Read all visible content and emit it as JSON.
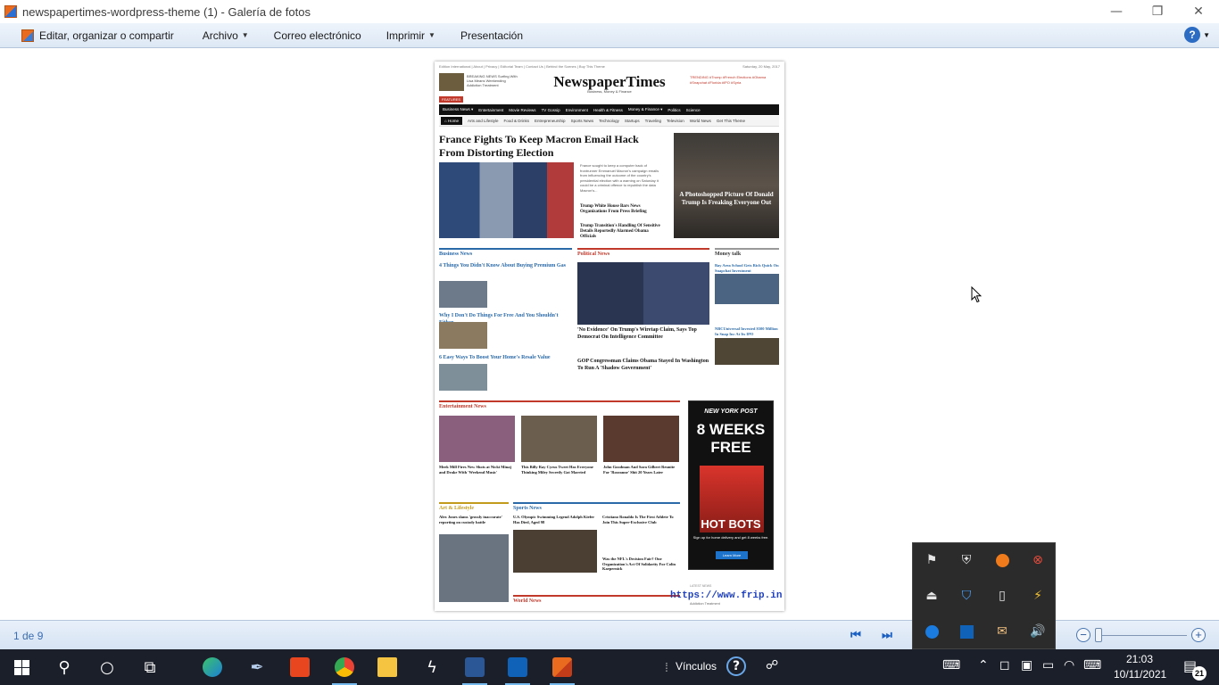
{
  "window": {
    "title": "newspapertimes-wordpress-theme (1) - Galería de fotos",
    "minimize_glyph": "—",
    "restore_glyph": "❐",
    "close_glyph": "✕"
  },
  "menubar": {
    "items": [
      {
        "label": "Editar, organizar o compartir",
        "has_dropdown": false
      },
      {
        "label": "Archivo",
        "has_dropdown": true
      },
      {
        "label": "Correo electrónico",
        "has_dropdown": false
      },
      {
        "label": "Imprimir",
        "has_dropdown": true
      },
      {
        "label": "Presentación",
        "has_dropdown": false
      }
    ],
    "help_glyph": "?"
  },
  "photo": {
    "top_links": "Edition International | About | Privacy | Editorial Team | Contact Us | Behind the Scenes | Buy This Theme",
    "top_date": "Saturday, 20 May, 2017",
    "logo": "NewspaperTimes",
    "logo_sub": "Business, Money & Finance",
    "breaking": "BREAKING NEWS Surfing With Lisa Means Weekending Addiction Treatment",
    "trending": "TRENDING #Trump #French Elections #Obama #Snapchat #Florida #IPO #Syria",
    "features_label": "FEATURES",
    "nav_primary": [
      "Business News ▾",
      "Entertainment",
      "Movie Reviews",
      "TV Gossip",
      "Environment",
      "Health & Fitness",
      "Money & Finance ▾",
      "Politics",
      "Science"
    ],
    "nav_secondary": [
      "⌂ Home",
      "Arts and Lifestyle",
      "Food & Drinks",
      "Entrepreneurship",
      "Sports News",
      "Technology",
      "Startups",
      "Traveling",
      "Television",
      "World News",
      "Get This Theme"
    ],
    "headline": "France Fights To Keep Macron Email Hack From Distorting Election",
    "main_text": "France sought to keep a computer hack of frontrunner Emmanuel Macron's campaign emails from influencing the outcome of the country's presidential election with a warning on Saturday it could be a criminal offence to republish the data Macron's...",
    "side_head_1": "Trump White House Bars News Organizations From Press Briefing",
    "side_head_2": "Trump Transition's Handling Of Sensitive Details Reportedly Alarmed Obama Officials",
    "right_caption": "A Photoshopped Picture Of Donald Trump Is Freaking Everyone Out",
    "sections": {
      "business": "Business News",
      "political": "Political News",
      "money": "Money talk",
      "entertainment": "Entertainment News",
      "art": "Art & Lifestyle",
      "sports": "Sports News",
      "world": "World News"
    },
    "business_articles": [
      "4 Things You Didn't Know About Buying Premium Gas",
      "Why I Don't Do Things For Free And You Shouldn't Either",
      "6 Easy Ways To Boost Your Home's Resale Value"
    ],
    "political_articles": [
      "'No Evidence' On Trump's Wiretap Claim, Says Top Democrat On Intelligence Committee",
      "GOP Congressman Claims Obama Stayed In Washington To Run A 'Shadow Government'"
    ],
    "money_articles": [
      "Bay Area School Gets Rich Quick On Snapchat Investment",
      "NBCUniversal Invested $500 Million In Snap Inc At Its IPO"
    ],
    "entertainment_articles": [
      "Meek Mill Fires New Shots at Nicki Minaj and Drake With 'Weekend Music'",
      "This Billy Ray Cyrus Tweet Has Everyone Thinking Miley Secretly Got Married",
      "John Goodman And Sara Gilbert Reunite For 'Roseanne' Shit 20 Years Later"
    ],
    "art_article": "Alex Jones slams 'grossly inaccurate' reporting on custody battle",
    "sports_articles": [
      "U.S. Olympic Swimming Legend Adolph Kiefer Has Died, Aged 98",
      "Cristiano Ronaldo Is The First Athlete To Join This Super-Exclusive Club",
      "Was the NFL's Decision Fair? One Organization's Act Of Solidarity For Colin Kaepernick"
    ],
    "ad": {
      "brand": "NEW YORK POST",
      "offer": "8 WEEKS FREE",
      "hot": "HOT BOTS",
      "sign": "Sign up for home delivery and get 8 weeks free.",
      "button": "Learn More"
    },
    "latest_news": "LATEST NEWS",
    "watermark": "https://www.frip.in",
    "watermark_sub": "Addiction Treatment"
  },
  "statusbar": {
    "page_count": "1 de 9"
  },
  "tray_popup": {
    "icons": [
      "monitor-flag-icon",
      "shield-alert-icon",
      "avast-icon",
      "network-error-icon",
      "usb-icon",
      "defender-icon",
      "device-icon",
      "accessory-icon",
      "teamviewer-icon",
      "outlook-icon",
      "mail-icon",
      "speaker-icon"
    ]
  },
  "taskbar": {
    "vinculos_label": "Vínculos",
    "clock_time": "21:03",
    "clock_date": "10/11/2021",
    "notification_count": "21",
    "accent": "#76b9ed"
  }
}
